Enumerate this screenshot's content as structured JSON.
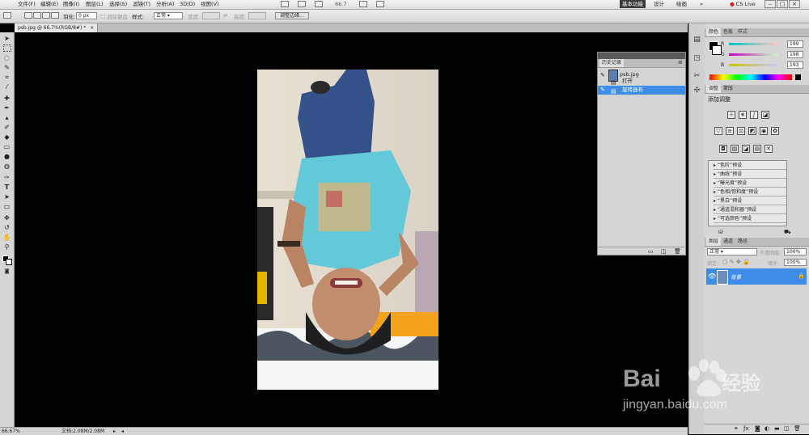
{
  "menubar": {
    "items": [
      "文件(F)",
      "编辑(E)",
      "图像(I)",
      "图层(L)",
      "选择(S)",
      "滤镜(T)",
      "分析(A)",
      "3D(D)",
      "视图(V)"
    ],
    "zoom": "66.7",
    "workspaces": [
      "基本功能",
      "设计",
      "绘画"
    ],
    "cs_live": "CS Live"
  },
  "options": {
    "feather_label": "羽化:",
    "feather_value": "0 px",
    "antialias_label": "消除锯齿",
    "style_label": "样式:",
    "style_value": "正常",
    "width_label": "宽度:",
    "height_label": "高度:",
    "refine_edge": "调整边缘..."
  },
  "document": {
    "tab_title": "psb.jpg @ 66.7%(RGB/8#) *",
    "close": "×"
  },
  "status": {
    "zoom": "66.67%",
    "doc_size": "文档:2.08M/2.08M"
  },
  "history": {
    "tab": "历史记录",
    "snapshot": "psb.jpg",
    "steps": [
      "打开",
      "旋转画布"
    ]
  },
  "color_panel": {
    "tabs": [
      "颜色",
      "色板",
      "样式"
    ],
    "r_label": "R",
    "r_value": "199",
    "g_label": "G",
    "g_value": "198",
    "b_label": "B",
    "b_value": "193"
  },
  "adjust_panel": {
    "tabs": [
      "调整",
      "蒙版"
    ],
    "title": "添加调整",
    "presets": [
      "“色阶”预设",
      "“曲线”预设",
      "“曝光度”预设",
      "“色相/饱和度”预设",
      "“黑白”预设",
      "“通道混和器”预设",
      "“可选颜色”预设"
    ]
  },
  "layers_panel": {
    "tabs": [
      "图层",
      "通道",
      "路径"
    ],
    "blend_mode": "正常",
    "opacity_label": "不透明度:",
    "opacity_value": "100%",
    "lock_label": "锁定:",
    "fill_label": "填充:",
    "fill_value": "100%",
    "layer_name": "背景"
  },
  "watermark": {
    "brand": "Bai",
    "brand2": "经验",
    "url": "jingyan.baidu.com"
  }
}
